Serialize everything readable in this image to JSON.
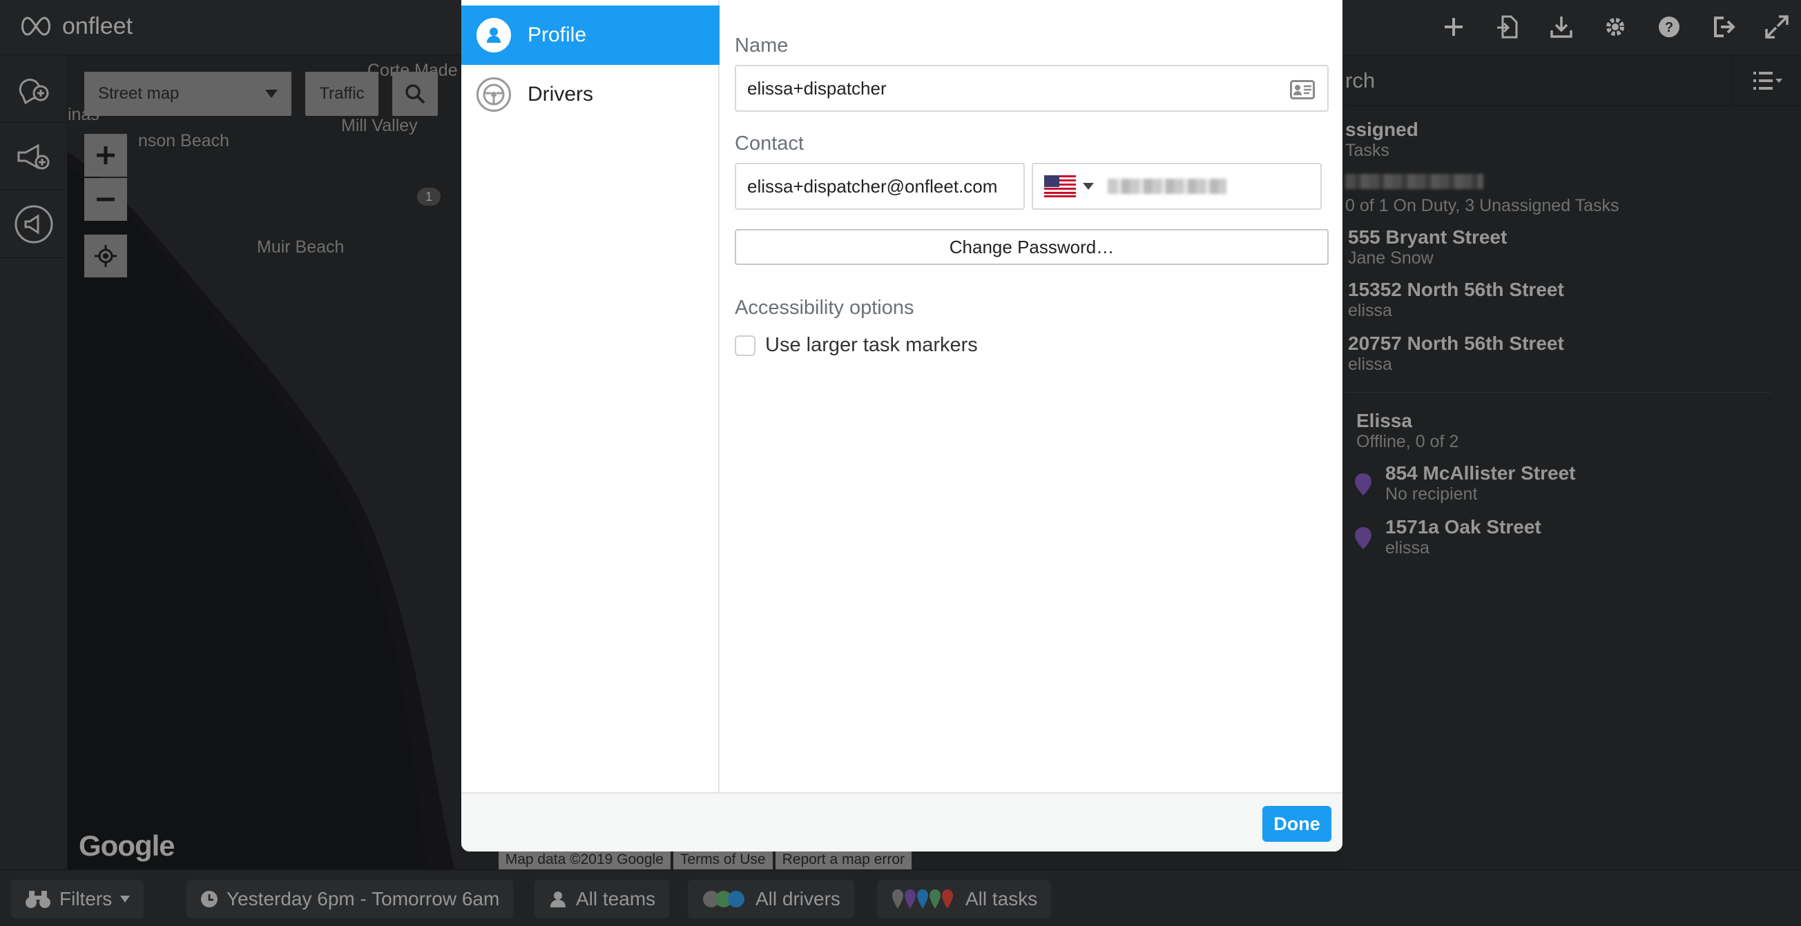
{
  "app": {
    "logo_text": "onfleet"
  },
  "toolbar": {
    "icons": [
      "plus-icon",
      "import-icon",
      "download-icon",
      "gear-icon",
      "help-icon",
      "logout-icon",
      "expand-icon"
    ]
  },
  "rail": {
    "icons": [
      "add-task-icon",
      "announcement-add-icon",
      "megaphone-icon"
    ]
  },
  "map": {
    "map_type_label": "Street map",
    "traffic_label": "Traffic",
    "labels": {
      "corte_madera": "Corte Made",
      "linas": "inas",
      "stinson_beach": "nson Beach",
      "mill_valley": "Mill Valley",
      "muir_beach": "Muir Beach",
      "route": "1"
    },
    "google_logo": "Google",
    "attribution": [
      "Map data ©2019 Google",
      "Terms of Use",
      "Report a map error"
    ]
  },
  "right_panel": {
    "search_text": "rch",
    "unassigned": {
      "title": "ssigned",
      "subtitle": "Tasks"
    },
    "summary": "0 of 1 On Duty, 3 Unassigned Tasks",
    "unassigned_tasks": [
      {
        "address": "555 Bryant Street",
        "recipient": "Jane Snow"
      },
      {
        "address": "15352 North 56th Street",
        "recipient": "elissa"
      },
      {
        "address": "20757 North 56th Street",
        "recipient": "elissa"
      }
    ],
    "driver": {
      "name": "Elissa",
      "status": "Offline, 0 of 2",
      "tasks": [
        {
          "address": "854 McAllister Street",
          "recipient": "No recipient"
        },
        {
          "address": "1571a Oak Street",
          "recipient": "elissa"
        }
      ]
    },
    "pin_color": "#7a55b3"
  },
  "bottom": {
    "filters_label": "Filters",
    "time_label": "Yesterday 6pm - Tomorrow 6am",
    "teams_label": "All teams",
    "drivers_label": "All drivers",
    "tasks_label": "All tasks"
  },
  "modal": {
    "nav": {
      "profile": "Profile",
      "drivers": "Drivers"
    },
    "name_label": "Name",
    "name_value": "elissa+dispatcher",
    "contact_label": "Contact",
    "email_value": "elissa+dispatcher@onfleet.com",
    "change_password": "Change Password…",
    "accessibility_label": "Accessibility options",
    "larger_markers_label": "Use larger task markers",
    "done_label": "Done",
    "accent_color": "#1a9cf2"
  }
}
